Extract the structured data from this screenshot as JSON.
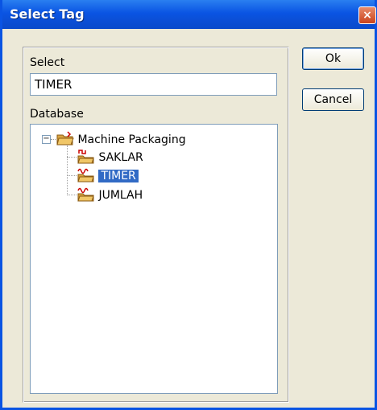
{
  "window": {
    "title": "Select Tag",
    "close_glyph": "×"
  },
  "fields": {
    "select_label": "Select",
    "select_value": "TIMER",
    "database_label": "Database"
  },
  "buttons": {
    "ok_label": "Ok",
    "cancel_label": "Cancel"
  },
  "tree": {
    "root_label": "Machine Packaging",
    "expander_glyph": "−",
    "items": [
      {
        "label": "SAKLAR",
        "icon": "digital-tag-icon",
        "selected": false
      },
      {
        "label": "TIMER",
        "icon": "analog-tag-icon",
        "selected": true
      },
      {
        "label": "JUMLAH",
        "icon": "analog-tag-icon",
        "selected": false
      }
    ]
  },
  "colors": {
    "titlebar": "#0a54e3",
    "selection": "#316ac5",
    "dialog_bg": "#ece9d8"
  }
}
